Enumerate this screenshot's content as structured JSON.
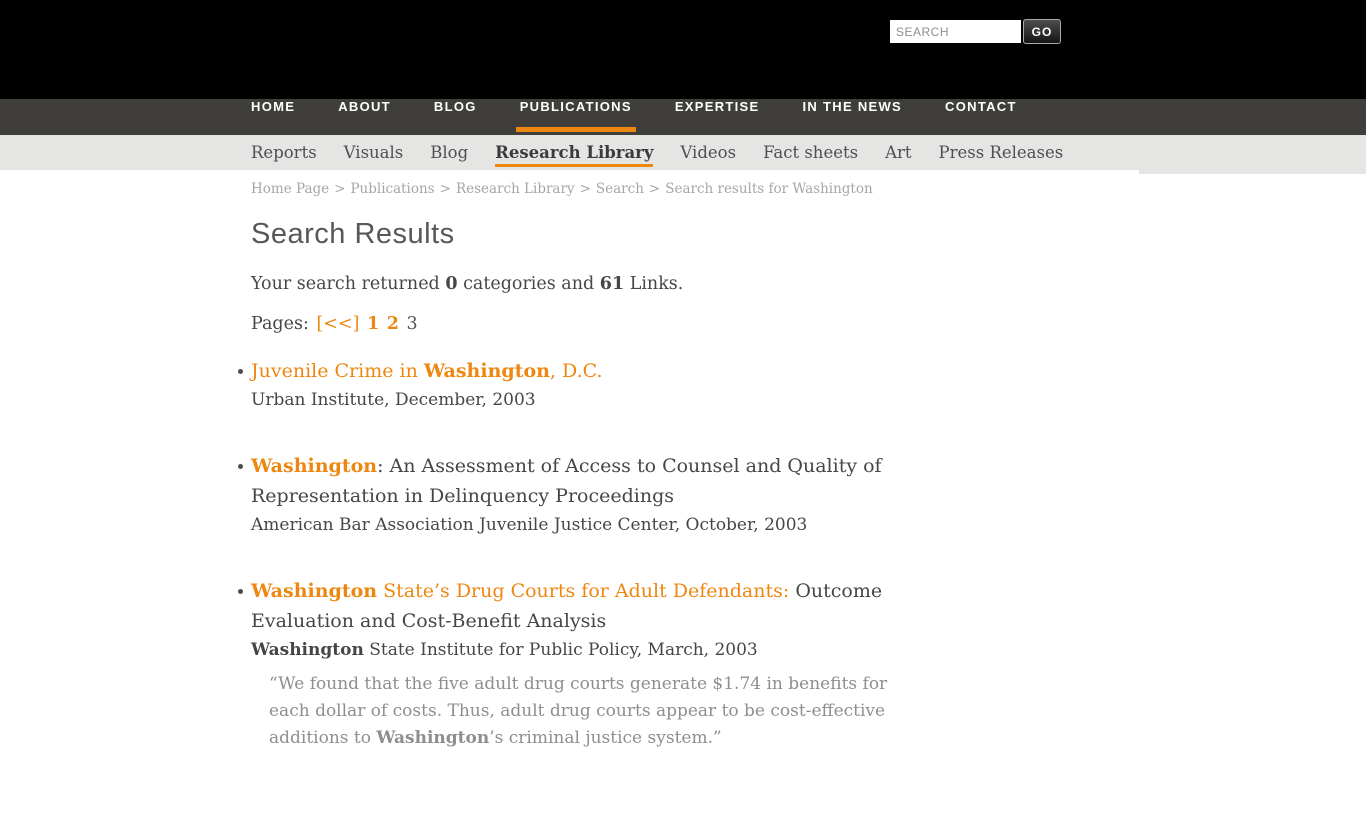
{
  "header": {
    "search": {
      "placeholder": "SEARCH",
      "go_label": "GO"
    }
  },
  "nav": {
    "items": [
      "HOME",
      "ABOUT",
      "BLOG",
      "PUBLICATIONS",
      "EXPERTISE",
      "IN THE NEWS",
      "CONTACT"
    ],
    "active": "PUBLICATIONS"
  },
  "subnav": {
    "items": [
      "Reports",
      "Visuals",
      "Blog",
      "Research Library",
      "Videos",
      "Fact sheets",
      "Art",
      "Press Releases"
    ],
    "active": "Research Library"
  },
  "breadcrumb": {
    "items": [
      "Home Page",
      "Publications",
      "Research Library",
      "Search",
      "Search results for Washington"
    ],
    "separator": ">"
  },
  "page": {
    "title": "Search Results",
    "summary": {
      "prefix": "Your search returned ",
      "categories_count": "0",
      "middle": " categories and ",
      "links_count": "61",
      "suffix": " Links."
    },
    "pagination": {
      "label": "Pages:",
      "back": "[<<]",
      "page1": "1",
      "page2": "2",
      "current": "3"
    }
  },
  "results": [
    {
      "title": {
        "pre": "Juvenile Crime in ",
        "match": "Washington",
        "post": ", D.C.",
        "rest": ""
      },
      "source": {
        "match": "",
        "text": "Urban Institute, December, 2003"
      }
    },
    {
      "title": {
        "pre": "",
        "match": "Washington",
        "post": "",
        "rest": ": An Assessment of Access to Counsel and Quality of Representation in Delinquency Proceedings"
      },
      "source": {
        "match": "",
        "text": "American Bar Association Juvenile Justice Center, October, 2003"
      }
    },
    {
      "title": {
        "pre": "",
        "match": "Washington",
        "post": " State’s Drug Courts for Adult Defendants:",
        "rest": " Outcome Evaluation and Cost-Benefit Analysis"
      },
      "source": {
        "match": "Washington",
        "text": " State Institute for Public Policy, March, 2003"
      },
      "quote": {
        "pre": "“We found that the five adult drug courts generate $1.74 in benefits for each dollar of costs. Thus, adult drug courts appear to be cost-effective additions to ",
        "match": "Washington",
        "post": "’s criminal justice system.”"
      }
    }
  ],
  "colors": {
    "accent_orange": "#ee8712",
    "nav_background": "#403e3b",
    "subnav_background": "#e5e5e4",
    "heading_text": "#57585a",
    "body_text": "#464646",
    "quote_text": "#8e8e8e",
    "breadcrumb_text": "#a6a6a6"
  }
}
